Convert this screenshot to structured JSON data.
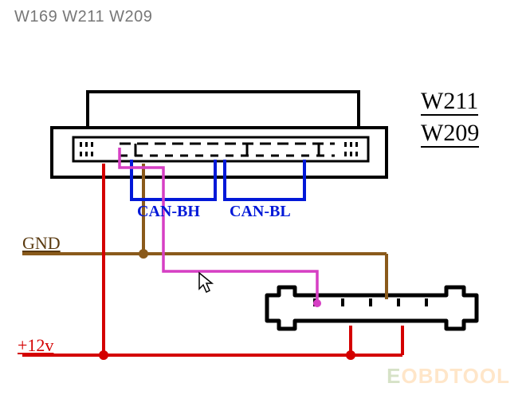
{
  "title": "W169 W211 W209",
  "model_top": "W211",
  "model_bottom": "W209",
  "can_bh": "CAN-BH",
  "can_bl": "CAN-BL",
  "gnd": "GND",
  "v12": "+12v",
  "watermark_e": "E",
  "watermark_rest": "OBDTOOL",
  "colors": {
    "outline": "#000000",
    "ground": "#8a5a1b",
    "power": "#d40000",
    "can": "#0018d8",
    "signal": "#d63fc4"
  },
  "connections": [
    {
      "name": "GND",
      "color_key": "ground",
      "desc": "ground bus from left, junction at ~180x, up into main connector pin-left region, branch right to secondary connector pin"
    },
    {
      "name": "+12v",
      "color_key": "power",
      "desc": "power bus from left bottom, junction under main connector, up into leftmost pin; branch right to two pins of secondary connector"
    },
    {
      "name": "CAN-BH",
      "color_key": "can",
      "desc": "blue U-loop left side inside main connector"
    },
    {
      "name": "CAN-BL",
      "color_key": "can",
      "desc": "blue U-loop right side inside main connector"
    },
    {
      "name": "signal",
      "color_key": "signal",
      "desc": "magenta wire from main connector inner pin down/right to secondary connector left pin"
    }
  ]
}
